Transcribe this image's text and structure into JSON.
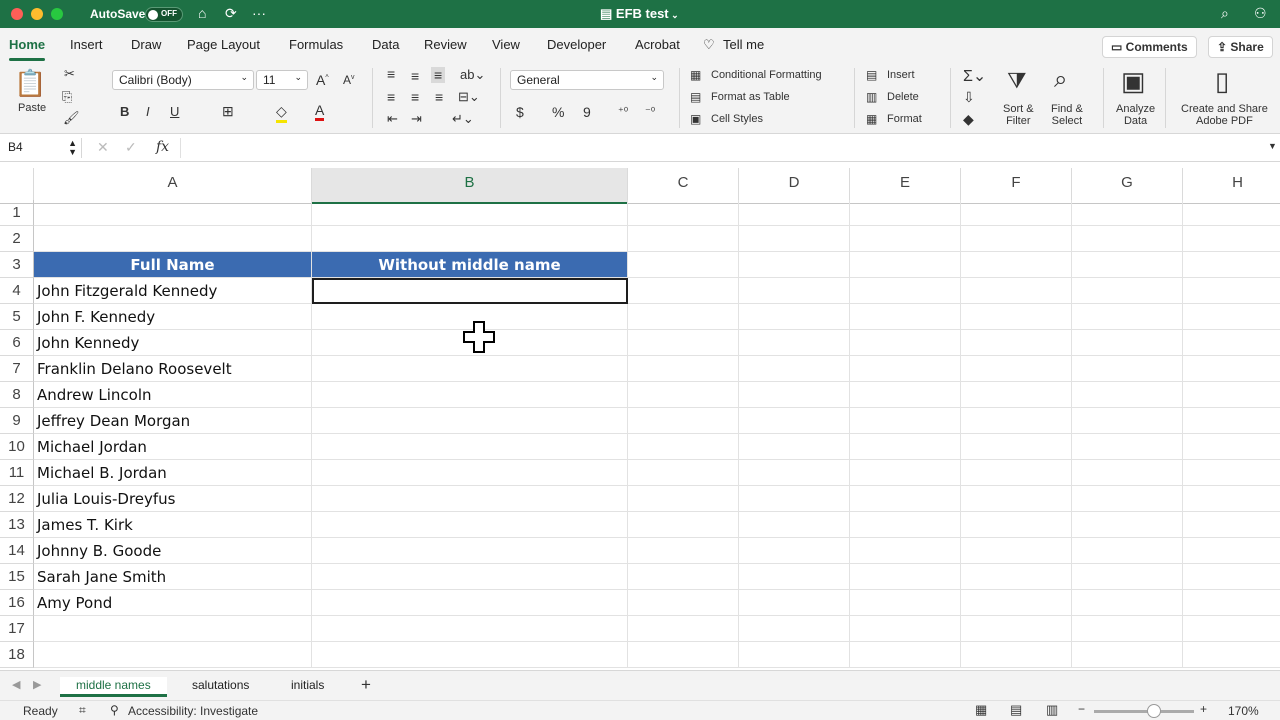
{
  "window": {
    "autosave_label": "AutoSave",
    "autosave_state": "OFF",
    "title": "EFB test"
  },
  "ribbon_tabs": [
    {
      "label": "Home",
      "active": true
    },
    {
      "label": "Insert"
    },
    {
      "label": "Draw"
    },
    {
      "label": "Page Layout"
    },
    {
      "label": "Formulas"
    },
    {
      "label": "Data"
    },
    {
      "label": "Review"
    },
    {
      "label": "View"
    },
    {
      "label": "Developer"
    },
    {
      "label": "Acrobat"
    },
    {
      "label": "Tell me"
    }
  ],
  "actions": {
    "comments": "Comments",
    "share": "Share"
  },
  "ribbon": {
    "paste": "Paste",
    "font_name": "Calibri (Body)",
    "font_size": "11",
    "bold": "B",
    "italic": "I",
    "underline": "U",
    "number_format": "General",
    "currency": "$",
    "percent": "%",
    "comma": "9",
    "conditional_formatting": "Conditional Formatting",
    "format_as_table": "Format as Table",
    "cell_styles": "Cell Styles",
    "insert": "Insert",
    "delete": "Delete",
    "format": "Format",
    "sort_filter": [
      "Sort &",
      "Filter"
    ],
    "find_select": [
      "Find &",
      "Select"
    ],
    "analyze_data": [
      "Analyze",
      "Data"
    ],
    "create_share": [
      "Create and Share",
      "Adobe PDF"
    ]
  },
  "formula_bar": {
    "name_box": "B4",
    "fx": "fx",
    "value": ""
  },
  "columns": [
    "A",
    "B",
    "C",
    "D",
    "E",
    "F",
    "G",
    "H"
  ],
  "rows": [
    "1",
    "2",
    "3",
    "4",
    "5",
    "6",
    "7",
    "8",
    "9",
    "10",
    "11",
    "12",
    "13",
    "14",
    "15",
    "16",
    "17",
    "18"
  ],
  "table": {
    "header": [
      "Full Name",
      "Without middle name"
    ],
    "names": [
      "John Fitzgerald Kennedy",
      "John F. Kennedy",
      "John Kennedy",
      "Franklin Delano Roosevelt",
      "Andrew Lincoln",
      "Jeffrey Dean Morgan",
      "Michael Jordan",
      "Michael B. Jordan",
      "Julia Louis-Dreyfus",
      "James T. Kirk",
      "Johnny B. Goode",
      "Sarah Jane Smith",
      "Amy Pond"
    ]
  },
  "sheets": [
    {
      "label": "middle names",
      "active": true
    },
    {
      "label": "salutations"
    },
    {
      "label": "initials"
    }
  ],
  "add_sheet": "+",
  "status": {
    "ready": "Ready",
    "accessibility": "Accessibility: Investigate",
    "zoom": "170%"
  },
  "colors": {
    "brand": "#1e7145",
    "table_header": "#3b6bb1"
  }
}
